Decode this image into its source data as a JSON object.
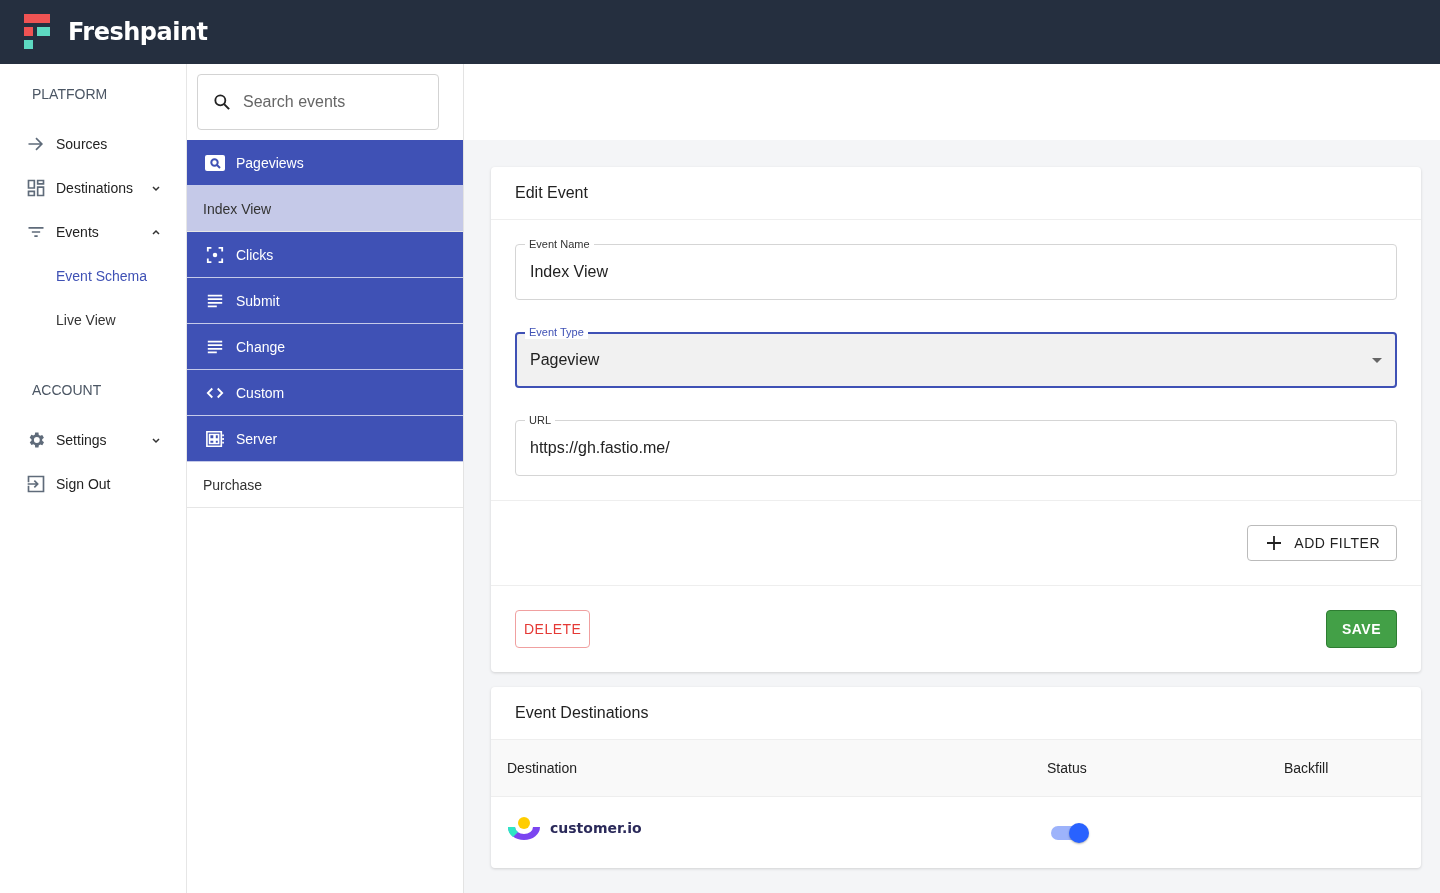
{
  "brand": "Freshpaint",
  "sidebar": {
    "sections": [
      {
        "title": "PLATFORM",
        "items": [
          {
            "label": "Sources",
            "kind": "link"
          },
          {
            "label": "Destinations",
            "kind": "expandable",
            "expanded": false
          },
          {
            "label": "Events",
            "kind": "expandable",
            "expanded": true,
            "children": [
              {
                "label": "Event Schema",
                "selected": true
              },
              {
                "label": "Live View",
                "selected": false
              }
            ]
          }
        ]
      },
      {
        "title": "ACCOUNT",
        "items": [
          {
            "label": "Settings",
            "kind": "expandable",
            "expanded": false
          },
          {
            "label": "Sign Out",
            "kind": "link"
          }
        ]
      }
    ]
  },
  "search": {
    "placeholder": "Search events"
  },
  "event_list": [
    {
      "label": "Pageviews",
      "kind": "category"
    },
    {
      "label": "Index View",
      "kind": "event",
      "selected": true
    },
    {
      "label": "Clicks",
      "kind": "category"
    },
    {
      "label": "Submit",
      "kind": "category"
    },
    {
      "label": "Change",
      "kind": "category"
    },
    {
      "label": "Custom",
      "kind": "category"
    },
    {
      "label": "Server",
      "kind": "category"
    },
    {
      "label": "Purchase",
      "kind": "event",
      "selected": false
    }
  ],
  "edit_event": {
    "title": "Edit Event",
    "fields": [
      {
        "label": "Event Name",
        "value": "Index View",
        "kind": "text",
        "focused": false
      },
      {
        "label": "Event Type",
        "value": "Pageview",
        "kind": "select",
        "focused": true
      },
      {
        "label": "URL",
        "value": "https://gh.fastio.me/",
        "kind": "text",
        "focused": false
      }
    ],
    "add_filter": "ADD FILTER",
    "delete": "DELETE",
    "save": "SAVE"
  },
  "event_destinations": {
    "title": "Event Destinations",
    "columns": [
      "Destination",
      "Status",
      "Backfill"
    ],
    "rows": [
      {
        "destination": "customer.io",
        "on": true
      }
    ]
  }
}
